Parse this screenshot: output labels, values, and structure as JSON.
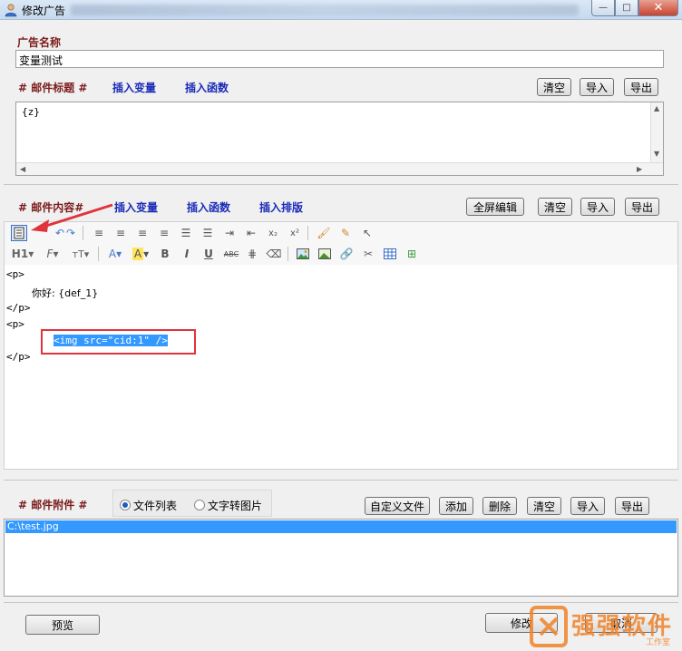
{
  "window": {
    "title": "修改广告",
    "controls": {
      "minimize": "—",
      "maximize": "□",
      "close": "✕"
    }
  },
  "ad_name": {
    "label": "广告名称",
    "value": "变量测试"
  },
  "mail_subject": {
    "label": "# 邮件标题 #",
    "insert_variable": "插入变量",
    "insert_function": "插入函数",
    "clear": "清空",
    "import": "导入",
    "export": "导出",
    "value": "{z}"
  },
  "mail_content": {
    "label": "# 邮件内容#",
    "insert_variable": "插入变量",
    "insert_function": "插入函数",
    "insert_layout": "插入排版",
    "fullscreen_edit": "全屏编辑",
    "clear": "清空",
    "import": "导入",
    "export": "导出",
    "lines": [
      "<p>",
      "        你好: {def_1}",
      "</p>",
      "<p>",
      "        <img src=\"cid:1\" />",
      "</p>"
    ]
  },
  "toolbar": {
    "heading": "H1",
    "font": "F",
    "font_size": "тT",
    "font_color": "A",
    "highlight": "A",
    "bold": "B",
    "italic": "I",
    "underline": "U",
    "strike": "ABC"
  },
  "attachments": {
    "label": "# 邮件附件 #",
    "radio_file_list": "文件列表",
    "radio_text_to_image": "文字转图片",
    "custom_file": "自定义文件",
    "add": "添加",
    "delete": "删除",
    "clear": "清空",
    "import": "导入",
    "export": "导出",
    "items": [
      "C:\\test.jpg"
    ]
  },
  "footer": {
    "preview": "预览",
    "modify": "修改",
    "cancel": "取消"
  },
  "watermark": {
    "text": "强强软件",
    "sub": "工作室"
  },
  "colors": {
    "label_dark": "#7b1b1b",
    "link_blue": "#1a2bb8",
    "selection": "#3399ff",
    "annotation_red": "#e0343c"
  }
}
